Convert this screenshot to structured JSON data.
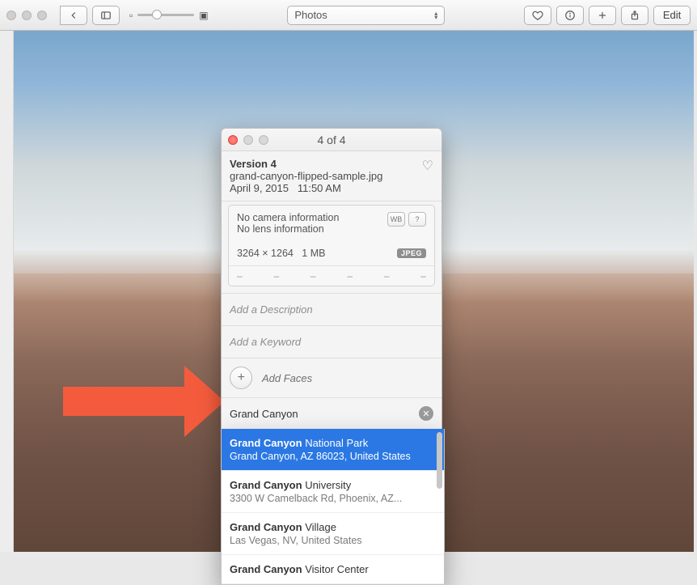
{
  "toolbar": {
    "category": "Photos",
    "edit_label": "Edit"
  },
  "panel": {
    "title": "4 of 4",
    "version_label": "Version 4",
    "filename": "grand-canyon-flipped-sample.jpg",
    "date": "April 9, 2015",
    "time": "11:50 AM",
    "camera_info": "No camera information",
    "lens_info": "No lens information",
    "dimensions": "3264 × 1264",
    "filesize": "1 MB",
    "format_badge": "JPEG",
    "dashes": [
      "–",
      "–",
      "–",
      "–",
      "–",
      "–"
    ],
    "description_placeholder": "Add a Description",
    "keyword_placeholder": "Add a Keyword",
    "add_faces_label": "Add Faces",
    "location_value": "Grand Canyon"
  },
  "suggestions": [
    {
      "bold": "Grand Canyon",
      "rest": " National Park",
      "detail": "Grand Canyon, AZ 86023, United States",
      "selected": true
    },
    {
      "bold": "Grand Canyon",
      "rest": " University",
      "detail": "3300 W Camelback Rd, Phoenix, AZ...",
      "selected": false
    },
    {
      "bold": "Grand Canyon",
      "rest": " Village",
      "detail": "Las Vegas, NV, United States",
      "selected": false
    },
    {
      "bold": "Grand Canyon",
      "rest": " Visitor Center",
      "detail": "",
      "selected": false
    }
  ]
}
